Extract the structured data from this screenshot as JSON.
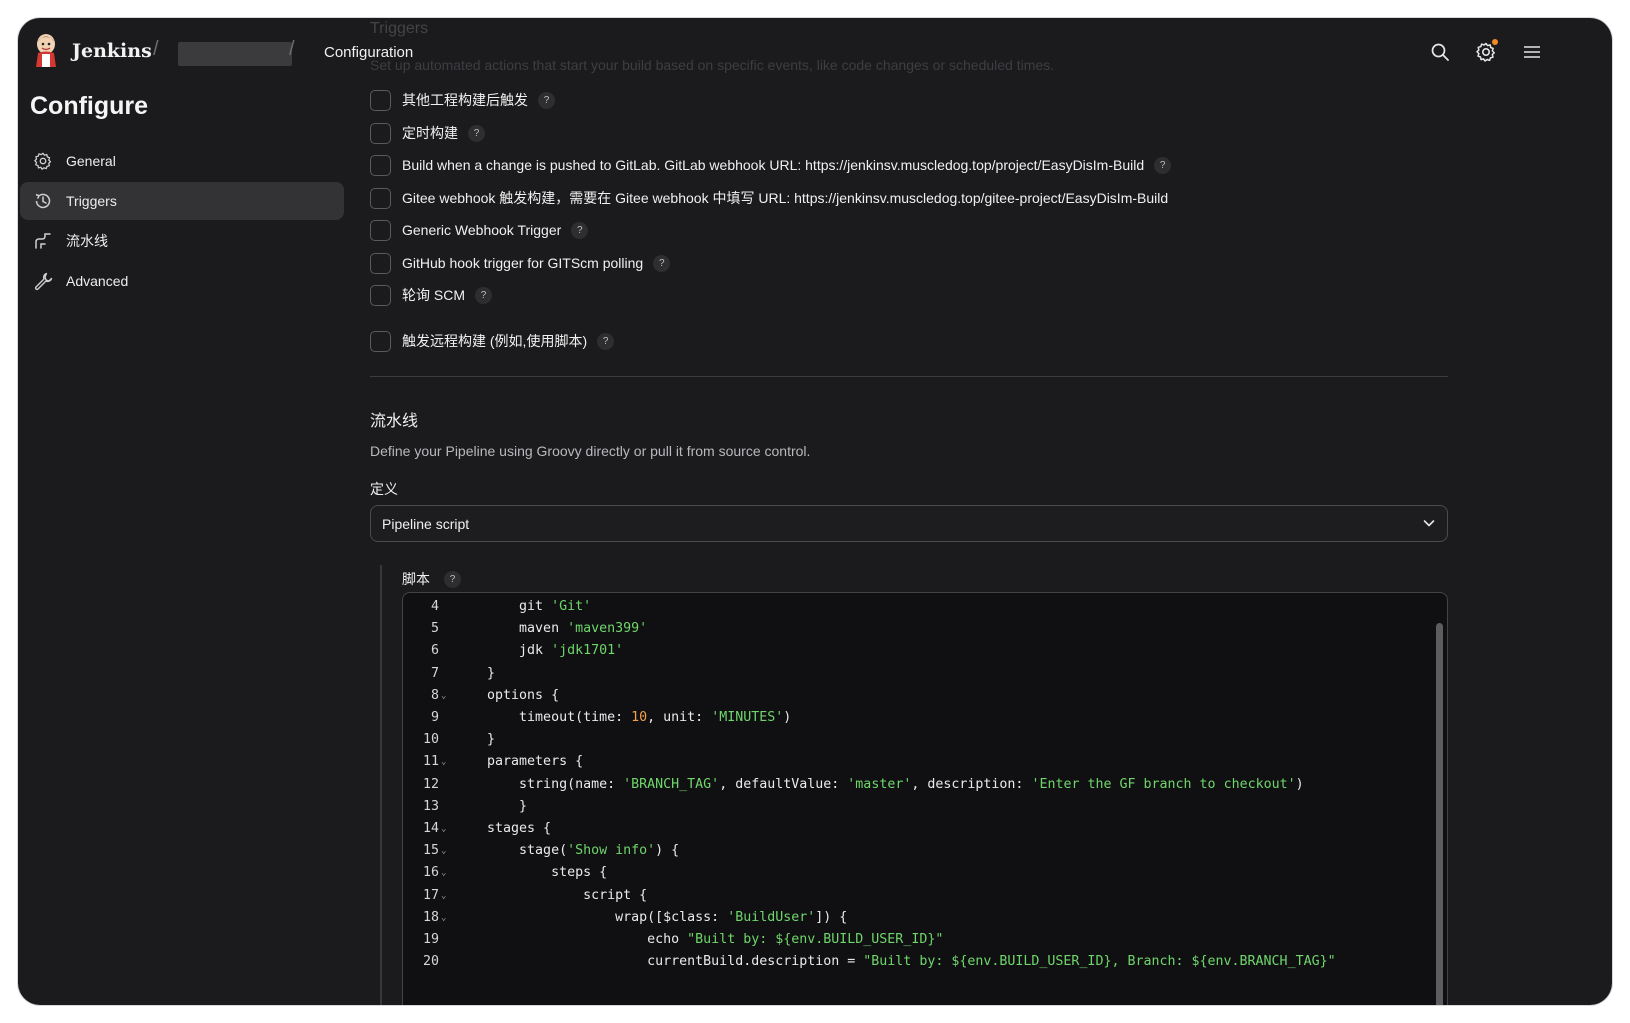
{
  "header": {
    "brand": "Jenkins",
    "breadcrumb_separator": "/",
    "breadcrumb_current": "Configuration",
    "icons": [
      "search-icon",
      "settings-icon",
      "menu-icon"
    ],
    "settings_notification_color": "#f08a24"
  },
  "sidebar": {
    "title": "Configure",
    "items": [
      {
        "label": "General",
        "icon": "gear-icon",
        "active": false
      },
      {
        "label": "Triggers",
        "icon": "clock-history-icon",
        "active": true
      },
      {
        "label": "流水线",
        "icon": "pipeline-icon",
        "active": false
      },
      {
        "label": "Advanced",
        "icon": "wrench-icon",
        "active": false
      }
    ]
  },
  "triggers": {
    "title": "Triggers",
    "description": "Set up automated actions that start your build based on specific events, like code changes or scheduled times.",
    "options": [
      {
        "label": "其他工程构建后触发",
        "checked": false,
        "help": "?"
      },
      {
        "label": "定时构建",
        "checked": false,
        "help": "?"
      },
      {
        "label": "Build when a change is pushed to GitLab. GitLab webhook URL: https://jenkinsv.muscledog.top/project/EasyDisIm-Build",
        "checked": false,
        "help": "?"
      },
      {
        "label": "Gitee webhook 触发构建，需要在 Gitee webhook 中填写 URL: https://jenkinsv.muscledog.top/gitee-project/EasyDisIm-Build",
        "checked": false,
        "help": ""
      },
      {
        "label": "Generic Webhook Trigger",
        "checked": false,
        "help": "?"
      },
      {
        "label": "GitHub hook trigger for GITScm polling",
        "checked": false,
        "help": "?"
      },
      {
        "label": "轮询 SCM",
        "checked": false,
        "help": "?"
      },
      {
        "label": "触发远程构建 (例如,使用脚本)",
        "checked": false,
        "help": "?"
      }
    ]
  },
  "pipeline": {
    "title": "流水线",
    "description": "Define your Pipeline using Groovy directly or pull it from source control.",
    "definition_label": "定义",
    "definition_value": "Pipeline script",
    "script_label": "脚本",
    "script_help": "?",
    "code_lines": [
      {
        "n": "4",
        "fold": false,
        "text": "        git 'Git'"
      },
      {
        "n": "5",
        "fold": false,
        "text": "        maven 'maven399'"
      },
      {
        "n": "6",
        "fold": false,
        "text": "        jdk 'jdk1701'"
      },
      {
        "n": "7",
        "fold": false,
        "text": "    }"
      },
      {
        "n": "8",
        "fold": true,
        "text": "    options {"
      },
      {
        "n": "9",
        "fold": false,
        "text": "        timeout(time: 10, unit: 'MINUTES')"
      },
      {
        "n": "10",
        "fold": false,
        "text": "    }"
      },
      {
        "n": "11",
        "fold": true,
        "text": "    parameters {"
      },
      {
        "n": "12",
        "fold": false,
        "text": "        string(name: 'BRANCH_TAG', defaultValue: 'master', description: 'Enter the GF branch to checkout')"
      },
      {
        "n": "13",
        "fold": false,
        "text": "        }"
      },
      {
        "n": "14",
        "fold": true,
        "text": "    stages {"
      },
      {
        "n": "15",
        "fold": true,
        "text": "        stage('Show info') {"
      },
      {
        "n": "16",
        "fold": true,
        "text": "            steps {"
      },
      {
        "n": "17",
        "fold": true,
        "text": "                script {"
      },
      {
        "n": "18",
        "fold": true,
        "text": "                    wrap([$class: 'BuildUser']) {"
      },
      {
        "n": "19",
        "fold": false,
        "text": "                        echo \"Built by: ${env.BUILD_USER_ID}\""
      },
      {
        "n": "20",
        "fold": false,
        "text": "                        currentBuild.description = \"Built by: ${env.BUILD_USER_ID}, Branch: ${env.BRANCH_TAG}\""
      }
    ]
  },
  "colors": {
    "background": "#1b1b1d",
    "active_nav": "#333336",
    "code_string": "#6fd66b",
    "code_number": "#f0a04b"
  }
}
